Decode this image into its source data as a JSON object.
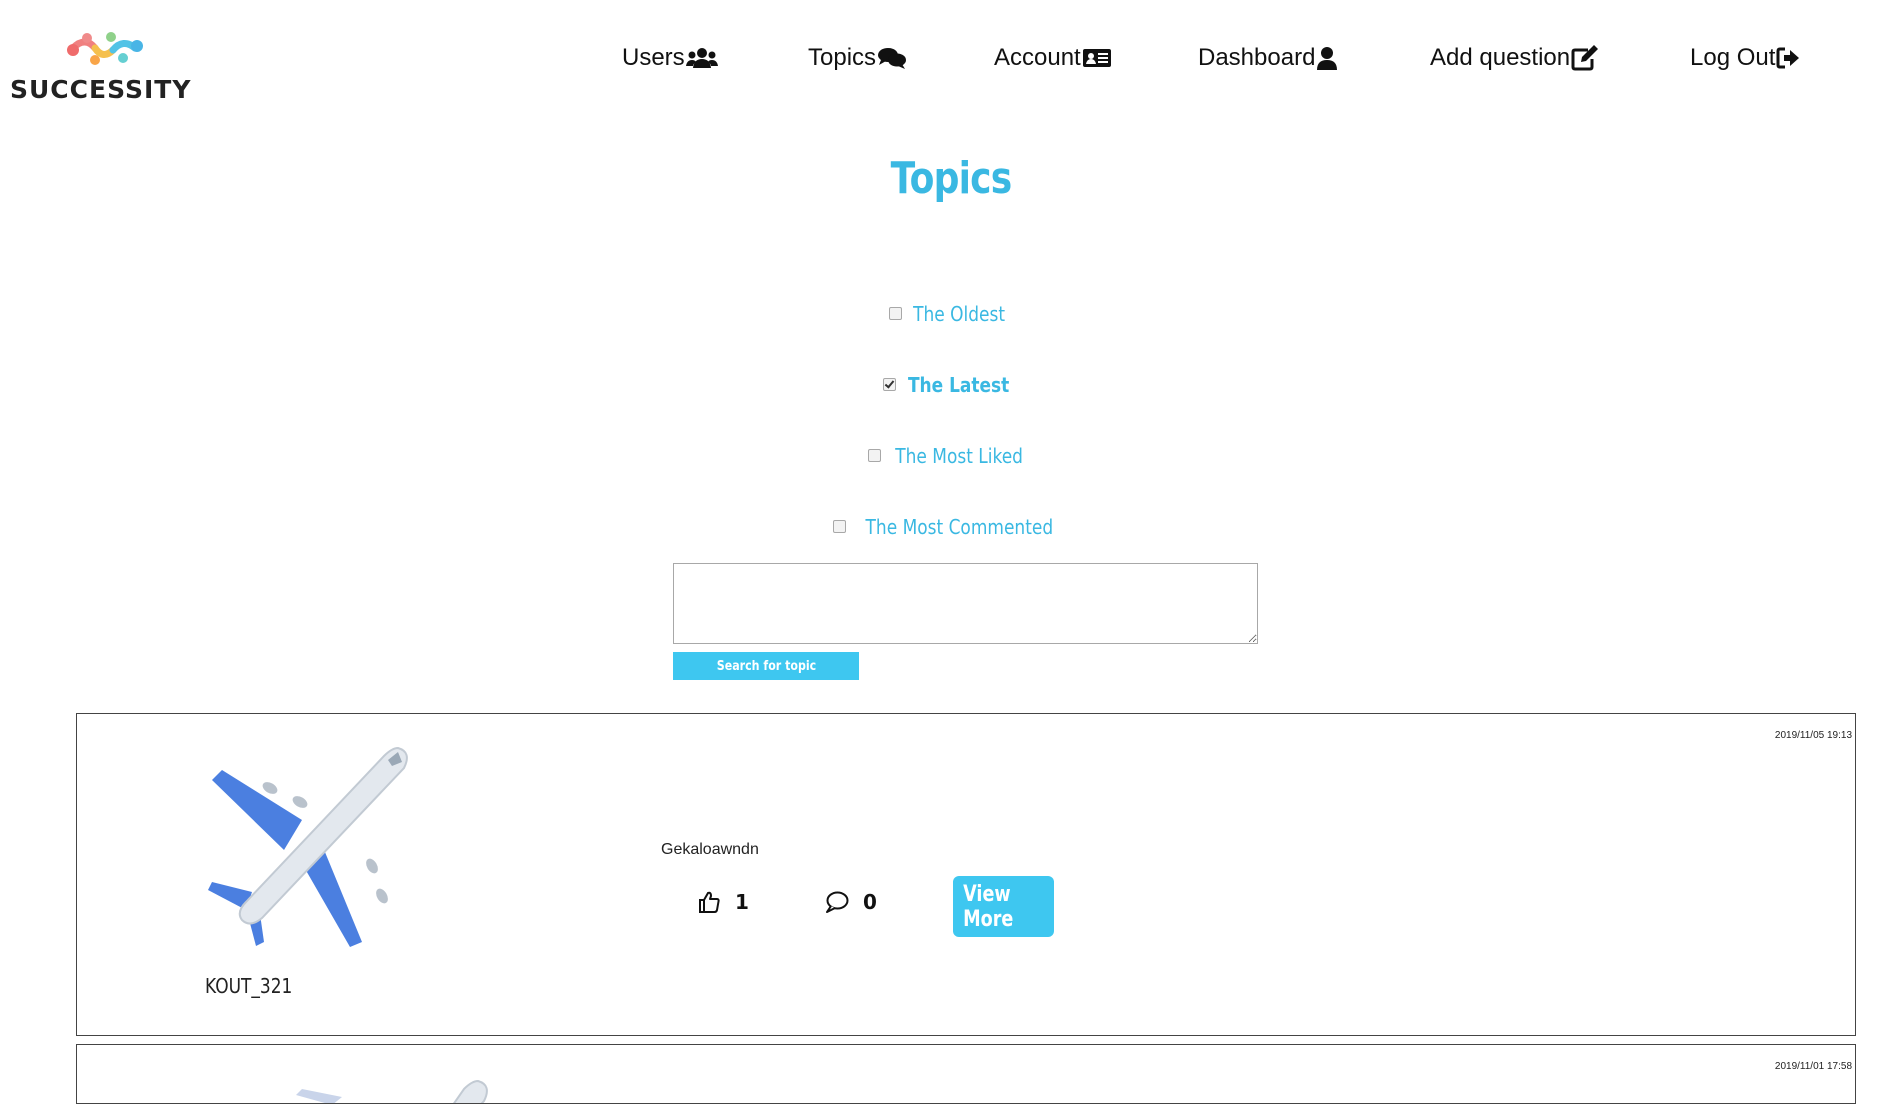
{
  "brand": {
    "name": "SUCCESSITY",
    "logo_icon": "logo-nodes-icon"
  },
  "nav": {
    "items": [
      {
        "label": "Users",
        "icon": "users-icon"
      },
      {
        "label": "Topics",
        "icon": "comments-icon"
      },
      {
        "label": "Account",
        "icon": "id-card-icon"
      },
      {
        "label": "Dashboard",
        "icon": "user-icon"
      },
      {
        "label": "Add question",
        "icon": "edit-icon"
      },
      {
        "label": "Log Out",
        "icon": "sign-out-icon"
      }
    ]
  },
  "page": {
    "title": "Topics"
  },
  "filters": [
    {
      "label": "The Oldest",
      "checked": false
    },
    {
      "label": "The Latest",
      "checked": true
    },
    {
      "label": "The Most Liked",
      "checked": false
    },
    {
      "label": "The Most Commented",
      "checked": false
    }
  ],
  "search": {
    "value": "",
    "placeholder": "",
    "button_label": "Search for topic"
  },
  "topics": [
    {
      "date": "2019/11/05 19:13",
      "avatar_icon": "airplane-icon",
      "username": "KOUT_321",
      "title": "Gekaloawndn",
      "likes": "1",
      "comments": "0",
      "view_more_label": "View More"
    },
    {
      "date": "2019/11/01 17:58",
      "avatar_icon": "airplane-icon"
    }
  ],
  "colors": {
    "accent": "#3ab8e2",
    "button": "#3ec7f0"
  }
}
